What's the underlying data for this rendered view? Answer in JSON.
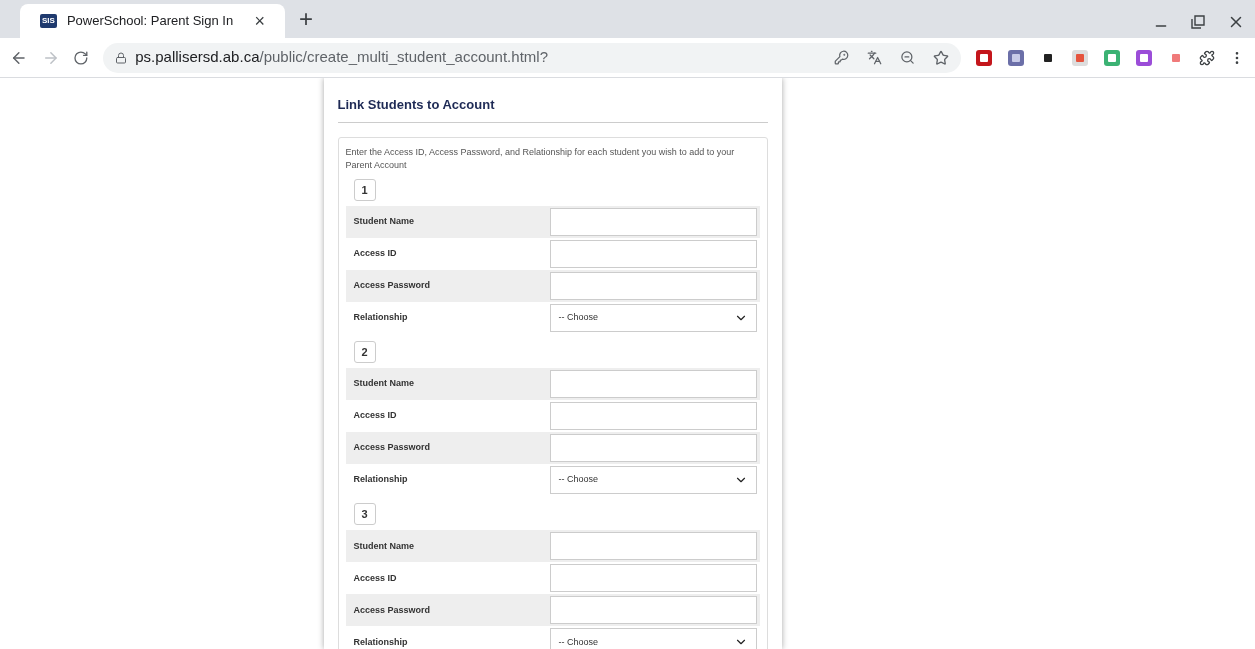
{
  "tab": {
    "favicon": "SIS",
    "title": "PowerSchool: Parent Sign In",
    "close": "×",
    "new_tab": "+"
  },
  "address_bar": {
    "host": "ps.pallisersd.ab.ca",
    "path": "/public/create_multi_student_account.html?"
  },
  "page": {
    "heading": "Link Students to Account",
    "instructions": "Enter the Access ID, Access Password, and Relationship for each student you wish to add to your Parent Account",
    "students": [
      {
        "number": "1",
        "fields": [
          {
            "kind": "text",
            "label": "Student Name"
          },
          {
            "kind": "text",
            "label": "Access ID"
          },
          {
            "kind": "text",
            "label": "Access Password"
          },
          {
            "kind": "select",
            "label": "Relationship",
            "value": "-- Choose"
          }
        ]
      },
      {
        "number": "2",
        "fields": [
          {
            "kind": "text",
            "label": "Student Name"
          },
          {
            "kind": "text",
            "label": "Access ID"
          },
          {
            "kind": "text",
            "label": "Access Password"
          },
          {
            "kind": "select",
            "label": "Relationship",
            "value": "-- Choose"
          }
        ]
      },
      {
        "number": "3",
        "fields": [
          {
            "kind": "text",
            "label": "Student Name"
          },
          {
            "kind": "text",
            "label": "Access ID"
          },
          {
            "kind": "text",
            "label": "Access Password"
          },
          {
            "kind": "select",
            "label": "Relationship",
            "value": "-- Choose"
          }
        ]
      }
    ]
  }
}
